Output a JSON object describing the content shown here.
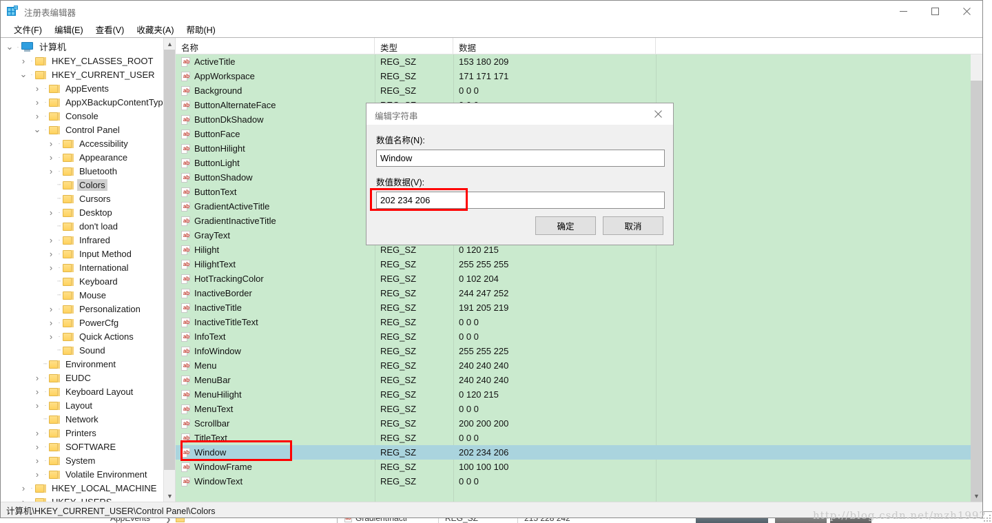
{
  "window": {
    "title": "注册表编辑器",
    "icon": "registry-editor-icon",
    "controls": {
      "minimize": "—",
      "maximize": "☐",
      "close": "✕"
    }
  },
  "menubar": [
    {
      "label": "文件(F)",
      "accel": "F"
    },
    {
      "label": "编辑(E)",
      "accel": "E"
    },
    {
      "label": "查看(V)",
      "accel": "V"
    },
    {
      "label": "收藏夹(A)",
      "accel": "A"
    },
    {
      "label": "帮助(H)",
      "accel": "H"
    }
  ],
  "tree": [
    {
      "label": "计算机",
      "depth": 0,
      "expander": "expanded",
      "icon": "computer-icon",
      "selected": false
    },
    {
      "label": "HKEY_CLASSES_ROOT",
      "depth": 1,
      "expander": "collapsed",
      "icon": "folder-icon",
      "selected": false
    },
    {
      "label": "HKEY_CURRENT_USER",
      "depth": 1,
      "expander": "expanded",
      "icon": "folder-icon",
      "selected": false
    },
    {
      "label": "AppEvents",
      "depth": 2,
      "expander": "collapsed",
      "icon": "folder-icon",
      "selected": false
    },
    {
      "label": "AppXBackupContentType",
      "depth": 2,
      "expander": "collapsed",
      "icon": "folder-icon",
      "selected": false
    },
    {
      "label": "Console",
      "depth": 2,
      "expander": "collapsed",
      "icon": "folder-icon",
      "selected": false
    },
    {
      "label": "Control Panel",
      "depth": 2,
      "expander": "expanded",
      "icon": "folder-icon",
      "selected": false
    },
    {
      "label": "Accessibility",
      "depth": 3,
      "expander": "collapsed",
      "icon": "folder-icon",
      "selected": false
    },
    {
      "label": "Appearance",
      "depth": 3,
      "expander": "collapsed",
      "icon": "folder-icon",
      "selected": false
    },
    {
      "label": "Bluetooth",
      "depth": 3,
      "expander": "collapsed",
      "icon": "folder-icon",
      "selected": false
    },
    {
      "label": "Colors",
      "depth": 3,
      "expander": "none",
      "icon": "folder-icon",
      "selected": true
    },
    {
      "label": "Cursors",
      "depth": 3,
      "expander": "none",
      "icon": "folder-icon",
      "selected": false
    },
    {
      "label": "Desktop",
      "depth": 3,
      "expander": "collapsed",
      "icon": "folder-icon",
      "selected": false
    },
    {
      "label": "don't load",
      "depth": 3,
      "expander": "none",
      "icon": "folder-icon",
      "selected": false
    },
    {
      "label": "Infrared",
      "depth": 3,
      "expander": "collapsed",
      "icon": "folder-icon",
      "selected": false
    },
    {
      "label": "Input Method",
      "depth": 3,
      "expander": "collapsed",
      "icon": "folder-icon",
      "selected": false
    },
    {
      "label": "International",
      "depth": 3,
      "expander": "collapsed",
      "icon": "folder-icon",
      "selected": false
    },
    {
      "label": "Keyboard",
      "depth": 3,
      "expander": "none",
      "icon": "folder-icon",
      "selected": false
    },
    {
      "label": "Mouse",
      "depth": 3,
      "expander": "none",
      "icon": "folder-icon",
      "selected": false
    },
    {
      "label": "Personalization",
      "depth": 3,
      "expander": "collapsed",
      "icon": "folder-icon",
      "selected": false
    },
    {
      "label": "PowerCfg",
      "depth": 3,
      "expander": "collapsed",
      "icon": "folder-icon",
      "selected": false
    },
    {
      "label": "Quick Actions",
      "depth": 3,
      "expander": "collapsed",
      "icon": "folder-icon",
      "selected": false
    },
    {
      "label": "Sound",
      "depth": 3,
      "expander": "none",
      "icon": "folder-icon",
      "selected": false
    },
    {
      "label": "Environment",
      "depth": 2,
      "expander": "none",
      "icon": "folder-icon",
      "selected": false
    },
    {
      "label": "EUDC",
      "depth": 2,
      "expander": "collapsed",
      "icon": "folder-icon",
      "selected": false
    },
    {
      "label": "Keyboard Layout",
      "depth": 2,
      "expander": "collapsed",
      "icon": "folder-icon",
      "selected": false
    },
    {
      "label": "Layout",
      "depth": 2,
      "expander": "collapsed",
      "icon": "folder-icon",
      "selected": false
    },
    {
      "label": "Network",
      "depth": 2,
      "expander": "none",
      "icon": "folder-icon",
      "selected": false
    },
    {
      "label": "Printers",
      "depth": 2,
      "expander": "collapsed",
      "icon": "folder-icon",
      "selected": false
    },
    {
      "label": "SOFTWARE",
      "depth": 2,
      "expander": "collapsed",
      "icon": "folder-icon",
      "selected": false
    },
    {
      "label": "System",
      "depth": 2,
      "expander": "collapsed",
      "icon": "folder-icon",
      "selected": false
    },
    {
      "label": "Volatile Environment",
      "depth": 2,
      "expander": "collapsed",
      "icon": "folder-icon",
      "selected": false
    },
    {
      "label": "HKEY_LOCAL_MACHINE",
      "depth": 1,
      "expander": "collapsed",
      "icon": "folder-icon",
      "selected": false
    },
    {
      "label": "HKEY_USERS",
      "depth": 1,
      "expander": "collapsed",
      "icon": "folder-icon",
      "selected": false
    }
  ],
  "list": {
    "columns": [
      "名称",
      "类型",
      "数据"
    ],
    "rows": [
      {
        "name": "ActiveTitle",
        "type": "REG_SZ",
        "data": "153 180 209",
        "selected": false
      },
      {
        "name": "AppWorkspace",
        "type": "REG_SZ",
        "data": "171 171 171",
        "selected": false
      },
      {
        "name": "Background",
        "type": "REG_SZ",
        "data": "0 0 0",
        "selected": false
      },
      {
        "name": "ButtonAlternateFace",
        "type": "REG_SZ",
        "data": "0 0 0",
        "selected": false
      },
      {
        "name": "ButtonDkShadow",
        "type": "REG_SZ",
        "data": "",
        "selected": false
      },
      {
        "name": "ButtonFace",
        "type": "REG_SZ",
        "data": "",
        "selected": false
      },
      {
        "name": "ButtonHilight",
        "type": "REG_SZ",
        "data": "",
        "selected": false
      },
      {
        "name": "ButtonLight",
        "type": "REG_SZ",
        "data": "",
        "selected": false
      },
      {
        "name": "ButtonShadow",
        "type": "REG_SZ",
        "data": "",
        "selected": false
      },
      {
        "name": "ButtonText",
        "type": "REG_SZ",
        "data": "",
        "selected": false
      },
      {
        "name": "GradientActiveTitle",
        "type": "REG_SZ",
        "data": "",
        "selected": false
      },
      {
        "name": "GradientInactiveTitle",
        "type": "REG_SZ",
        "data": "",
        "selected": false
      },
      {
        "name": "GrayText",
        "type": "REG_SZ",
        "data": "",
        "selected": false
      },
      {
        "name": "Hilight",
        "type": "REG_SZ",
        "data": "0 120 215",
        "selected": false
      },
      {
        "name": "HilightText",
        "type": "REG_SZ",
        "data": "255 255 255",
        "selected": false
      },
      {
        "name": "HotTrackingColor",
        "type": "REG_SZ",
        "data": "0 102 204",
        "selected": false
      },
      {
        "name": "InactiveBorder",
        "type": "REG_SZ",
        "data": "244 247 252",
        "selected": false
      },
      {
        "name": "InactiveTitle",
        "type": "REG_SZ",
        "data": "191 205 219",
        "selected": false
      },
      {
        "name": "InactiveTitleText",
        "type": "REG_SZ",
        "data": "0 0 0",
        "selected": false
      },
      {
        "name": "InfoText",
        "type": "REG_SZ",
        "data": "0 0 0",
        "selected": false
      },
      {
        "name": "InfoWindow",
        "type": "REG_SZ",
        "data": "255 255 225",
        "selected": false
      },
      {
        "name": "Menu",
        "type": "REG_SZ",
        "data": "240 240 240",
        "selected": false
      },
      {
        "name": "MenuBar",
        "type": "REG_SZ",
        "data": "240 240 240",
        "selected": false
      },
      {
        "name": "MenuHilight",
        "type": "REG_SZ",
        "data": "0 120 215",
        "selected": false
      },
      {
        "name": "MenuText",
        "type": "REG_SZ",
        "data": "0 0 0",
        "selected": false
      },
      {
        "name": "Scrollbar",
        "type": "REG_SZ",
        "data": "200 200 200",
        "selected": false
      },
      {
        "name": "TitleText",
        "type": "REG_SZ",
        "data": "0 0 0",
        "selected": false
      },
      {
        "name": "Window",
        "type": "REG_SZ",
        "data": "202 234 206",
        "selected": true
      },
      {
        "name": "WindowFrame",
        "type": "REG_SZ",
        "data": "100 100 100",
        "selected": false
      },
      {
        "name": "WindowText",
        "type": "REG_SZ",
        "data": "0 0 0",
        "selected": false
      }
    ]
  },
  "dialog": {
    "title": "编辑字符串",
    "name_label": "数值名称(N):",
    "name_value": "Window",
    "data_label": "数值数据(V):",
    "data_value": "202 234 206",
    "ok_label": "确定",
    "cancel_label": "取消",
    "close_icon": "close-icon"
  },
  "statusbar": {
    "path": "计算机\\HKEY_CURRENT_USER\\Control Panel\\Colors"
  },
  "watermark": {
    "text": "http://blog.csdn.net/mzh1992"
  },
  "background_window": {
    "tree_item": "AppEvents",
    "list_name": "GradientInacti",
    "list_type": "REG_SZ",
    "list_data": "215 228 242"
  },
  "colors": {
    "list_background": "#caeace",
    "selection": "#aad4de",
    "annotation": "#ff0000",
    "folder": "#ffd25e"
  }
}
